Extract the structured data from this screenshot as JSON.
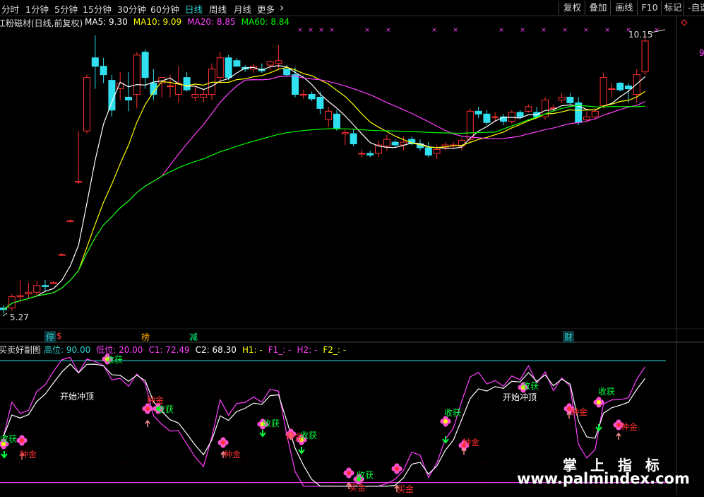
{
  "toolbar": {
    "periods": [
      "分时",
      "1分钟",
      "5分钟",
      "15分钟",
      "30分钟",
      "60分钟",
      "日线",
      "周线",
      "月线",
      "更多"
    ],
    "active": "日线",
    "more_arrow": "›",
    "right_buttons": [
      "复权",
      "叠加",
      "画线",
      "F10",
      "标记",
      "-自选"
    ]
  },
  "main_panel": {
    "stock_title": "江粉磁材(日线,前复权)",
    "ma_labels": [
      {
        "text": "MA5: 9.30",
        "color": "#ffffff"
      },
      {
        "text": "MA10: 9.09",
        "color": "#ffff00"
      },
      {
        "text": "MA20: 8.85",
        "color": "#ff40ff"
      },
      {
        "text": "MA60: 8.84",
        "color": "#00ff00"
      }
    ],
    "high_label": "10.15",
    "low_label": "5.27",
    "right_edge_label": "9",
    "event_markers": [
      {
        "text": "停",
        "color": "#2bd4d4"
      },
      {
        "text": "$",
        "color": "#ff4040"
      },
      {
        "text": "榜",
        "color": "#ffaa00"
      },
      {
        "text": "减",
        "color": "#00ff80"
      },
      {
        "text": "财",
        "color": "#2bd4d4"
      }
    ]
  },
  "sub_panel": {
    "title": "买卖好副图",
    "params": [
      {
        "text": "高位: 90.00",
        "color": "#2bd4d4"
      },
      {
        "text": "低位: 20.00",
        "color": "#ff40ff"
      },
      {
        "text": "C1: 72.49",
        "color": "#ff40ff"
      },
      {
        "text": "C2: 68.30",
        "color": "#ffffff"
      },
      {
        "text": "H1: -",
        "color": "#ffff00"
      },
      {
        "text": "F1_: -",
        "color": "#ff40ff"
      },
      {
        "text": "H2: -",
        "color": "#ff40ff"
      },
      {
        "text": "F2_: -",
        "color": "#ffff00"
      }
    ],
    "annotations": {
      "start_top": "开始冲顶",
      "harvest": "收获",
      "gold": "种金",
      "buy_gold": "买金"
    }
  },
  "watermark": {
    "line1": "掌 上 指 标",
    "line2": "www.palmindex.com"
  },
  "colors": {
    "up": "#ff3030",
    "down": "#30e0f0",
    "ma5": "#ffffff",
    "ma10": "#ffff00",
    "ma20": "#ff40ff",
    "ma60": "#00ff00",
    "high_line": "#2bd4d4",
    "low_line": "#ff40ff"
  },
  "chart_data": [
    {
      "type": "candlestick",
      "title": "江粉磁材(日线,前复权)",
      "price_range": [
        5.27,
        10.15
      ],
      "candles": [
        {
          "o": 5.3,
          "h": 5.35,
          "l": 5.2,
          "c": 5.27
        },
        {
          "o": 5.3,
          "h": 5.55,
          "l": 5.25,
          "c": 5.5
        },
        {
          "o": 5.5,
          "h": 5.8,
          "l": 5.4,
          "c": 5.52
        },
        {
          "o": 5.55,
          "h": 5.75,
          "l": 5.48,
          "c": 5.58
        },
        {
          "o": 5.58,
          "h": 5.78,
          "l": 5.5,
          "c": 5.7
        },
        {
          "o": 5.7,
          "h": 5.8,
          "l": 5.6,
          "c": 5.68
        },
        {
          "o": 5.75,
          "h": 5.78,
          "l": 5.73,
          "c": 5.75
        },
        {
          "o": 6.25,
          "h": 6.28,
          "l": 6.22,
          "c": 6.25
        },
        {
          "o": 6.85,
          "h": 6.88,
          "l": 6.82,
          "c": 6.85
        },
        {
          "o": 7.55,
          "h": 8.45,
          "l": 7.5,
          "c": 7.55
        },
        {
          "o": 8.45,
          "h": 9.45,
          "l": 8.4,
          "c": 9.4
        },
        {
          "o": 9.75,
          "h": 10.15,
          "l": 9.2,
          "c": 9.6
        },
        {
          "o": 9.6,
          "h": 9.75,
          "l": 9.3,
          "c": 9.45
        },
        {
          "o": 9.35,
          "h": 9.45,
          "l": 8.7,
          "c": 8.82
        },
        {
          "o": 9.2,
          "h": 9.5,
          "l": 9.0,
          "c": 9.3
        },
        {
          "o": 9.05,
          "h": 9.5,
          "l": 8.8,
          "c": 9.0
        },
        {
          "o": 9.1,
          "h": 9.85,
          "l": 8.85,
          "c": 9.8
        },
        {
          "o": 9.85,
          "h": 9.9,
          "l": 9.2,
          "c": 9.4
        },
        {
          "o": 9.3,
          "h": 9.55,
          "l": 9.0,
          "c": 9.1
        },
        {
          "o": 9.3,
          "h": 9.4,
          "l": 9.05,
          "c": 9.4
        },
        {
          "o": 9.25,
          "h": 9.45,
          "l": 9.05,
          "c": 9.25
        },
        {
          "o": 9.1,
          "h": 9.6,
          "l": 8.95,
          "c": 9.3
        },
        {
          "o": 9.4,
          "h": 9.5,
          "l": 9.15,
          "c": 9.18
        },
        {
          "o": 9.05,
          "h": 9.25,
          "l": 8.98,
          "c": 9.1
        },
        {
          "o": 9.05,
          "h": 9.18,
          "l": 8.95,
          "c": 9.1
        },
        {
          "o": 9.1,
          "h": 9.65,
          "l": 9.0,
          "c": 9.55
        },
        {
          "o": 9.4,
          "h": 9.85,
          "l": 9.3,
          "c": 9.75
        },
        {
          "o": 9.75,
          "h": 9.8,
          "l": 9.35,
          "c": 9.4
        },
        {
          "o": 9.7,
          "h": 9.75,
          "l": 9.6,
          "c": 9.6
        },
        {
          "o": 9.58,
          "h": 9.62,
          "l": 9.5,
          "c": 9.55
        },
        {
          "o": 9.55,
          "h": 9.65,
          "l": 9.48,
          "c": 9.6
        },
        {
          "o": 9.55,
          "h": 9.65,
          "l": 9.48,
          "c": 9.52
        },
        {
          "o": 9.62,
          "h": 9.7,
          "l": 9.52,
          "c": 9.68
        },
        {
          "o": 9.65,
          "h": 9.98,
          "l": 9.55,
          "c": 9.7
        },
        {
          "o": 9.55,
          "h": 9.62,
          "l": 9.42,
          "c": 9.45
        },
        {
          "o": 9.45,
          "h": 9.58,
          "l": 9.05,
          "c": 9.1
        },
        {
          "o": 9.1,
          "h": 9.18,
          "l": 9.02,
          "c": 9.1
        },
        {
          "o": 9.1,
          "h": 9.15,
          "l": 8.98,
          "c": 9.02
        },
        {
          "o": 9.05,
          "h": 9.15,
          "l": 8.75,
          "c": 8.85
        },
        {
          "o": 8.65,
          "h": 8.88,
          "l": 8.52,
          "c": 8.8
        },
        {
          "o": 8.75,
          "h": 8.82,
          "l": 8.45,
          "c": 8.5
        },
        {
          "o": 8.4,
          "h": 8.48,
          "l": 8.2,
          "c": 8.42
        },
        {
          "o": 8.4,
          "h": 8.48,
          "l": 8.18,
          "c": 8.22
        },
        {
          "o": 8.05,
          "h": 8.12,
          "l": 7.98,
          "c": 8.05
        },
        {
          "o": 8.05,
          "h": 8.1,
          "l": 7.98,
          "c": 8.02
        },
        {
          "o": 8.05,
          "h": 8.28,
          "l": 7.98,
          "c": 8.2
        },
        {
          "o": 8.18,
          "h": 8.38,
          "l": 8.1,
          "c": 8.3
        },
        {
          "o": 8.25,
          "h": 8.3,
          "l": 8.15,
          "c": 8.2
        },
        {
          "o": 8.2,
          "h": 8.35,
          "l": 8.1,
          "c": 8.25
        },
        {
          "o": 8.3,
          "h": 8.35,
          "l": 8.2,
          "c": 8.22
        },
        {
          "o": 8.22,
          "h": 8.3,
          "l": 8.1,
          "c": 8.15
        },
        {
          "o": 8.15,
          "h": 8.25,
          "l": 7.98,
          "c": 8.02
        },
        {
          "o": 8.05,
          "h": 8.2,
          "l": 7.95,
          "c": 8.12
        },
        {
          "o": 8.15,
          "h": 8.25,
          "l": 8.1,
          "c": 8.2
        },
        {
          "o": 8.2,
          "h": 8.25,
          "l": 8.14,
          "c": 8.2
        },
        {
          "o": 8.18,
          "h": 8.32,
          "l": 8.1,
          "c": 8.28
        },
        {
          "o": 8.3,
          "h": 8.85,
          "l": 8.25,
          "c": 8.8
        },
        {
          "o": 8.8,
          "h": 8.88,
          "l": 8.68,
          "c": 8.75
        },
        {
          "o": 8.75,
          "h": 8.82,
          "l": 8.55,
          "c": 8.6
        },
        {
          "o": 8.7,
          "h": 8.78,
          "l": 8.62,
          "c": 8.7
        },
        {
          "o": 8.7,
          "h": 8.75,
          "l": 8.55,
          "c": 8.62
        },
        {
          "o": 8.62,
          "h": 8.82,
          "l": 8.58,
          "c": 8.78
        },
        {
          "o": 8.78,
          "h": 8.82,
          "l": 8.66,
          "c": 8.7
        },
        {
          "o": 8.8,
          "h": 8.92,
          "l": 8.78,
          "c": 8.88
        },
        {
          "o": 8.78,
          "h": 8.88,
          "l": 8.68,
          "c": 8.7
        },
        {
          "o": 8.7,
          "h": 9.05,
          "l": 8.65,
          "c": 9.0
        },
        {
          "o": 8.85,
          "h": 8.92,
          "l": 8.8,
          "c": 8.86
        },
        {
          "o": 9.0,
          "h": 9.12,
          "l": 8.95,
          "c": 9.05
        },
        {
          "o": 9.05,
          "h": 9.12,
          "l": 8.92,
          "c": 8.95
        },
        {
          "o": 8.95,
          "h": 9.05,
          "l": 8.55,
          "c": 8.6
        },
        {
          "o": 8.65,
          "h": 8.8,
          "l": 8.6,
          "c": 8.7
        },
        {
          "o": 8.7,
          "h": 8.85,
          "l": 8.65,
          "c": 8.8
        },
        {
          "o": 8.9,
          "h": 9.48,
          "l": 8.85,
          "c": 9.4
        },
        {
          "o": 9.2,
          "h": 9.3,
          "l": 9.05,
          "c": 9.2
        },
        {
          "o": 9.3,
          "h": 9.32,
          "l": 9.15,
          "c": 9.18
        },
        {
          "o": 9.25,
          "h": 9.3,
          "l": 8.95,
          "c": 9.2
        },
        {
          "o": 9.1,
          "h": 9.55,
          "l": 8.95,
          "c": 9.45
        },
        {
          "o": 9.5,
          "h": 10.15,
          "l": 9.45,
          "c": 10.05
        }
      ]
    },
    {
      "type": "line",
      "title": "买卖好副图",
      "ylim": [
        15,
        95
      ],
      "reference_lines": [
        {
          "name": "高位",
          "value": 90
        },
        {
          "name": "低位",
          "value": 20
        }
      ]
    }
  ]
}
